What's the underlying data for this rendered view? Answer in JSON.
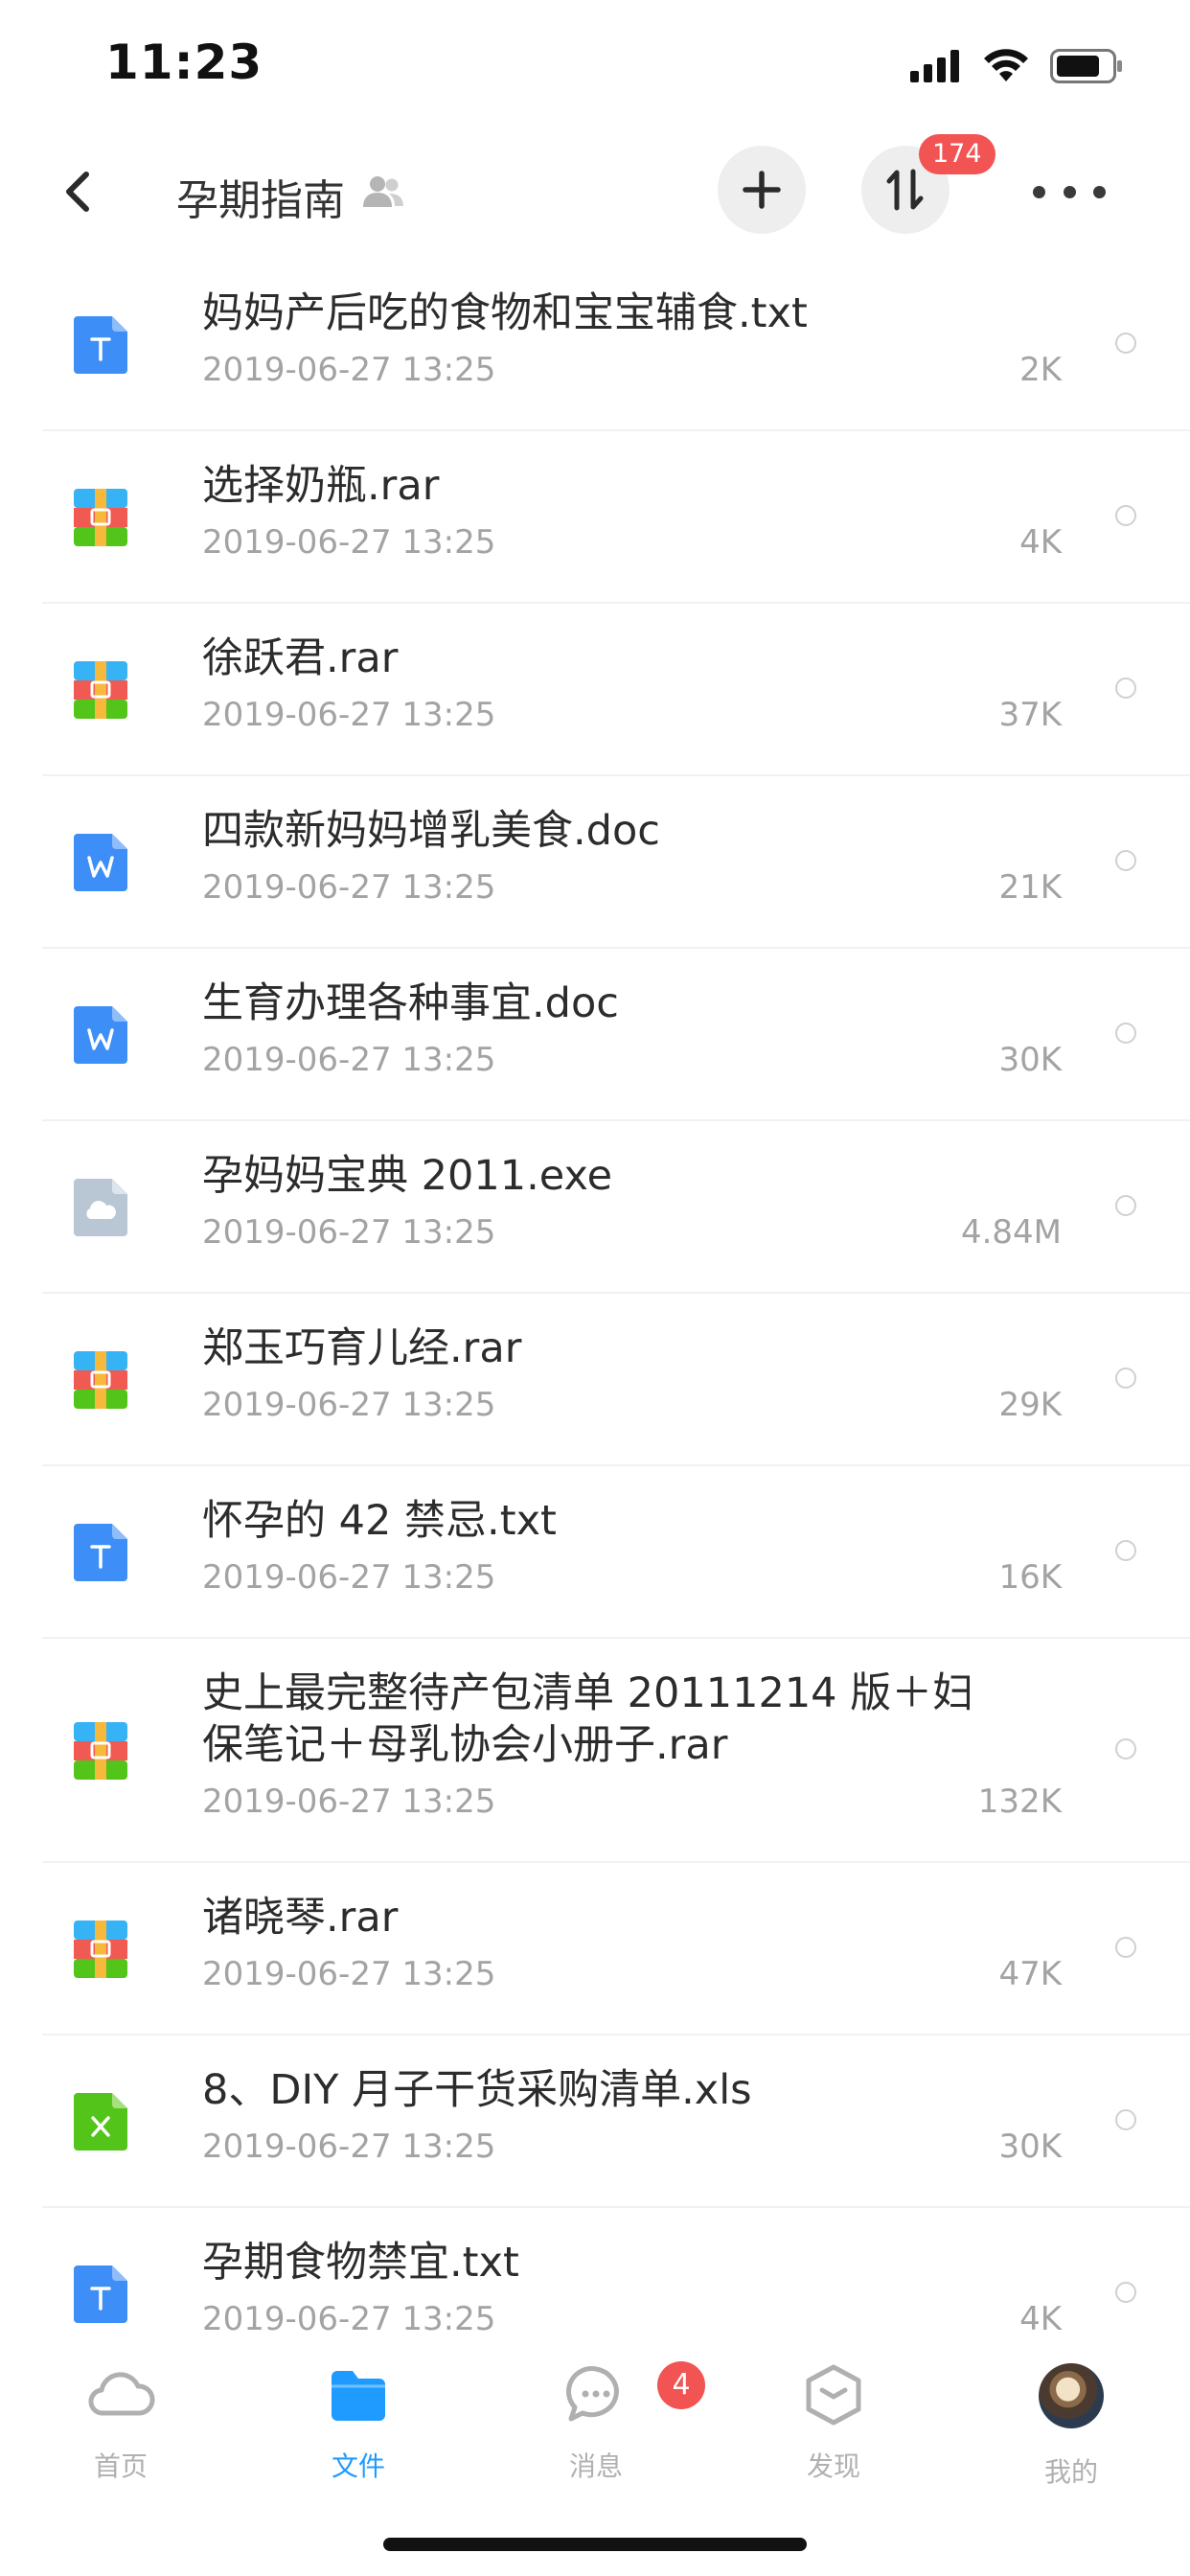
{
  "status_bar": {
    "time": "11:23"
  },
  "header": {
    "title": "孕期指南",
    "transfer_badge": "174"
  },
  "files": [
    {
      "name": "妈妈产后吃的食物和宝宝辅食.txt",
      "date": "2019-06-27 13:25",
      "size": "2K",
      "type": "txt"
    },
    {
      "name": "选择奶瓶.rar",
      "date": "2019-06-27 13:25",
      "size": "4K",
      "type": "rar"
    },
    {
      "name": "徐跃君.rar",
      "date": "2019-06-27 13:25",
      "size": "37K",
      "type": "rar"
    },
    {
      "name": "四款新妈妈增乳美食.doc",
      "date": "2019-06-27 13:25",
      "size": "21K",
      "type": "doc"
    },
    {
      "name": "生育办理各种事宜.doc",
      "date": "2019-06-27 13:25",
      "size": "30K",
      "type": "doc"
    },
    {
      "name": "孕妈妈宝典 2011.exe",
      "date": "2019-06-27 13:25",
      "size": "4.84M",
      "type": "exe"
    },
    {
      "name": "郑玉巧育儿经.rar",
      "date": "2019-06-27 13:25",
      "size": "29K",
      "type": "rar"
    },
    {
      "name": "怀孕的 42 禁忌.txt",
      "date": "2019-06-27 13:25",
      "size": "16K",
      "type": "txt"
    },
    {
      "name": "史上最完整待产包清单 20111214 版＋妇保笔记＋母乳协会小册子.rar",
      "date": "2019-06-27 13:25",
      "size": "132K",
      "type": "rar"
    },
    {
      "name": "诸晓琴.rar",
      "date": "2019-06-27 13:25",
      "size": "47K",
      "type": "rar"
    },
    {
      "name": "8、DIY 月子干货采购清单.xls",
      "date": "2019-06-27 13:25",
      "size": "30K",
      "type": "xls"
    },
    {
      "name": "孕期食物禁宜.txt",
      "date": "2019-06-27 13:25",
      "size": "4K",
      "type": "txt"
    }
  ],
  "tabbar": {
    "home": "首页",
    "files": "文件",
    "messages": "消息",
    "messages_badge": "4",
    "discover": "发现",
    "mine": "我的"
  },
  "colors": {
    "accent": "#1f9bff",
    "badge": "#f25353",
    "doc_blue": "#3d8ef7",
    "xls_green": "#52c41a",
    "exe_gray": "#b9c6d3"
  }
}
